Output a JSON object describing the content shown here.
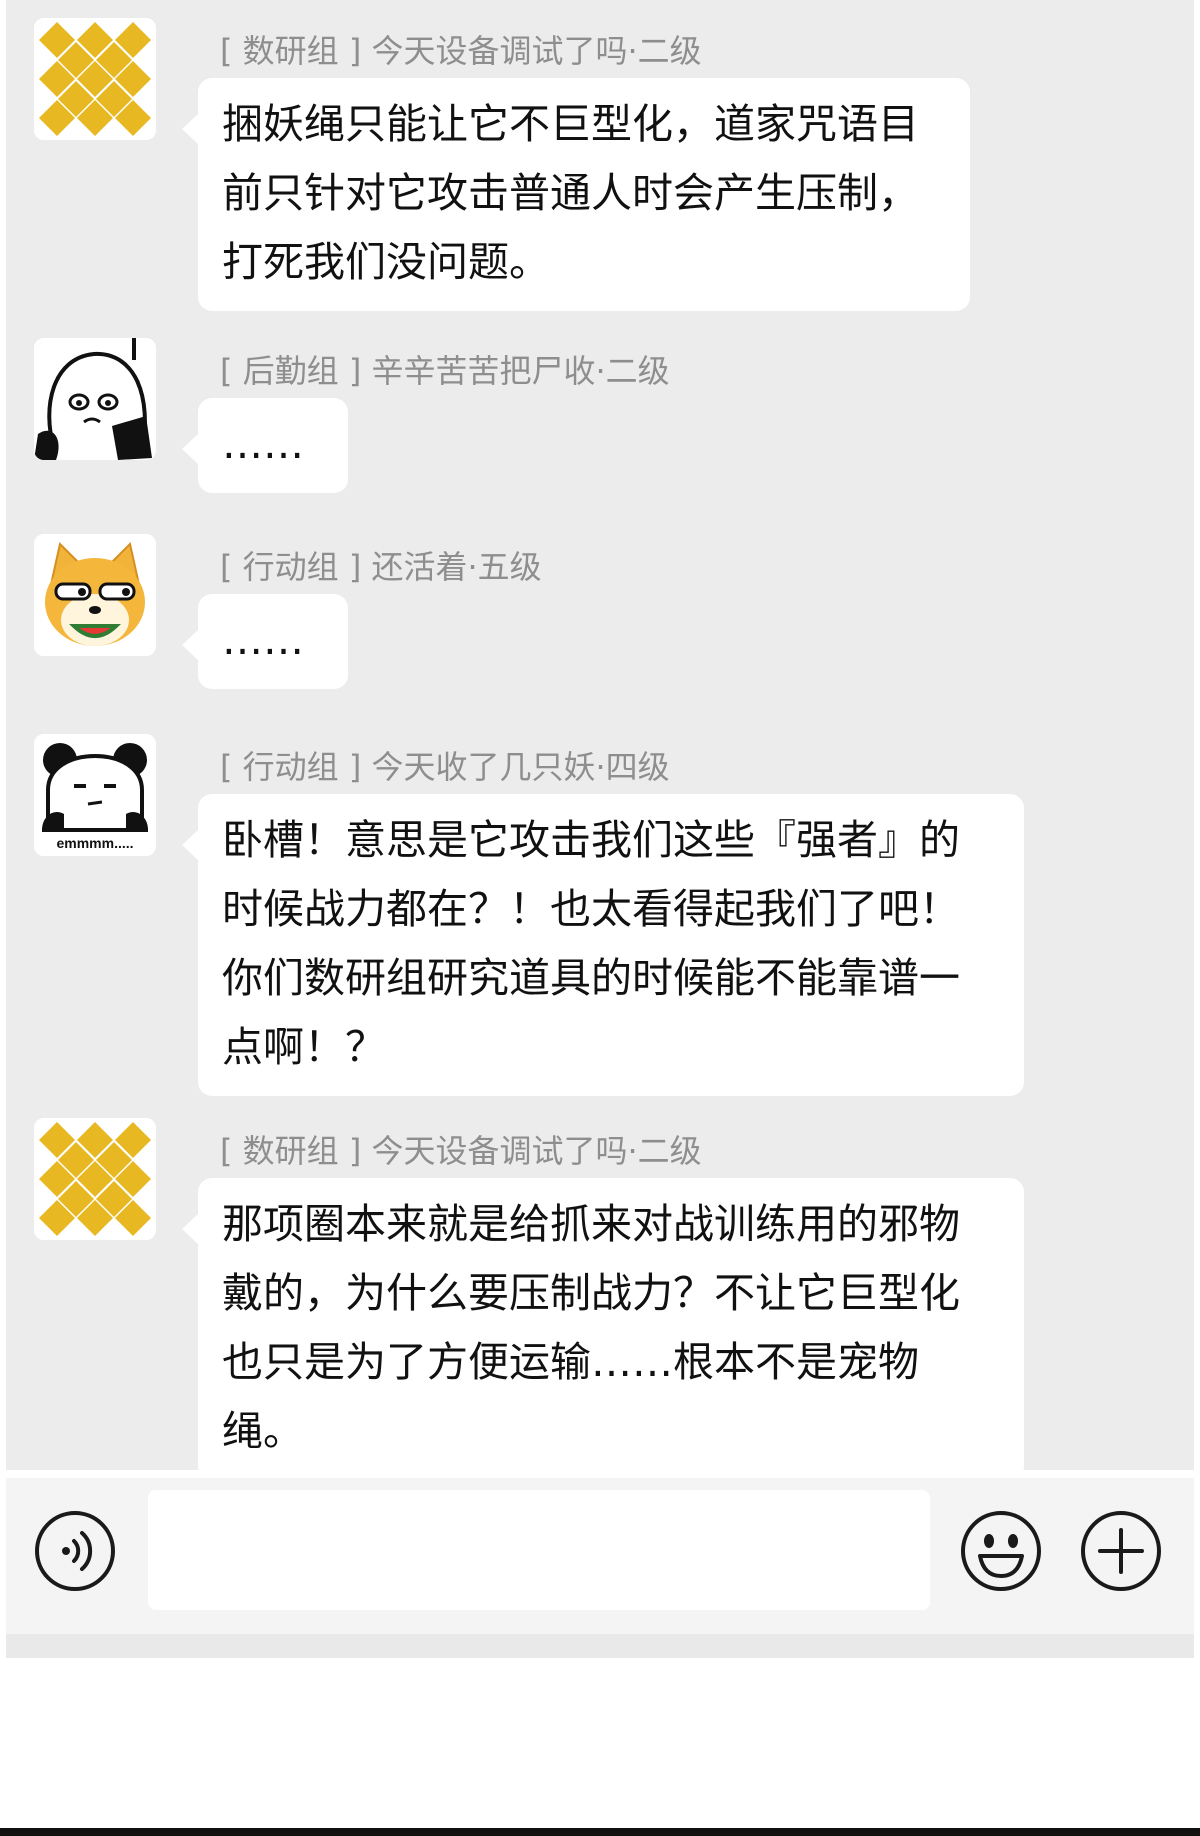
{
  "messages": [
    {
      "avatar_icon": "yellow-diamond-pattern-icon",
      "sender": "[ 数研组 ] 今天设备调试了吗·二级",
      "text": "捆妖绳只能让它不巨型化，道家咒语目\n前只针对它攻击普通人时会产生压制，\n打死我们没问题。"
    },
    {
      "avatar_icon": "crying-cartoon-girl-icon",
      "sender": "[ 后勤组 ] 辛辛苦苦把尸收·二级",
      "text": "……"
    },
    {
      "avatar_icon": "shiba-dog-eating-watermelon-icon",
      "sender": "[ 行动组 ] 还活着·五级",
      "text": "……"
    },
    {
      "avatar_icon": "panda-meme-icon",
      "avatar_caption": "emmmm.....",
      "sender": "[ 行动组 ] 今天收了几只妖·四级",
      "text": "卧槽！意思是它攻击我们这些『强者』的\n时候战力都在？！也太看得起我们了吧！\n你们数研组研究道具的时候能不能靠谱一\n点啊！？"
    },
    {
      "avatar_icon": "yellow-diamond-pattern-icon",
      "sender": "[ 数研组 ] 今天设备调试了吗·二级",
      "text": "那项圈本来就是给抓来对战训练用的邪物\n戴的，为什么要压制战力？不让它巨型化\n也只是为了方便运输……根本不是宠物绳。"
    }
  ],
  "input_bar": {
    "voice_icon": "voice-icon",
    "input_value": "",
    "emoji_icon": "smiley-icon",
    "plus_icon": "plus-circle-icon"
  },
  "colors": {
    "chat_background": "#ececec",
    "bubble": "#ffffff",
    "sender_text": "#8e8e8e",
    "diamond_yellow": "#e8b823"
  }
}
